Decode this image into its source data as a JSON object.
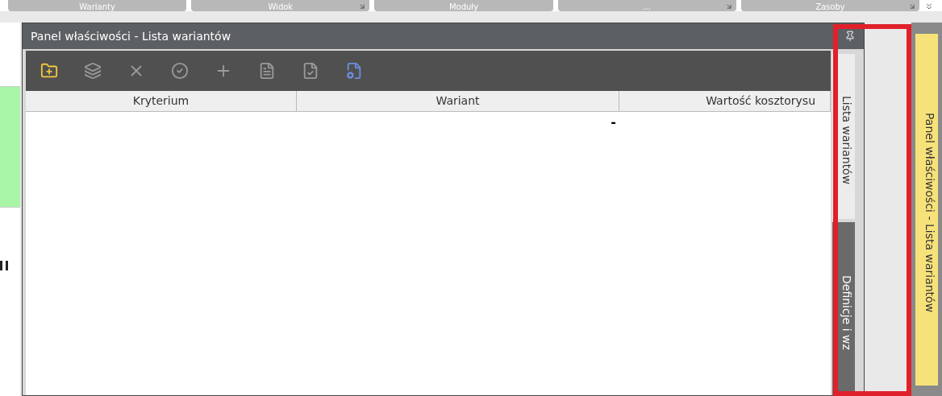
{
  "ribbon_groups": [
    {
      "label": "Warianty",
      "launcher": false
    },
    {
      "label": "Widok",
      "launcher": true
    },
    {
      "label": "Moduły",
      "launcher": false
    },
    {
      "label": "...",
      "launcher": true
    },
    {
      "label": "Zasoby",
      "launcher": true
    }
  ],
  "panel": {
    "title": "Panel właściwości - Lista wariantów",
    "toolbar": [
      {
        "kind": "add-folder",
        "disabled": false
      },
      {
        "kind": "cards",
        "disabled": true
      },
      {
        "kind": "delete",
        "disabled": true
      },
      {
        "kind": "accept",
        "disabled": true
      },
      {
        "kind": "add",
        "disabled": true
      },
      {
        "kind": "document",
        "disabled": true
      },
      {
        "kind": "document-check",
        "disabled": true
      },
      {
        "kind": "document-settings",
        "disabled": false
      }
    ],
    "table": {
      "columns": [
        "Kryterium",
        "Wariant",
        "Wartość kosztorysu"
      ],
      "rows": [
        [
          "",
          "-",
          ""
        ]
      ]
    },
    "tabs": [
      {
        "label": "Lista wariantów",
        "selected": true
      },
      {
        "label": "Definicje i wz",
        "selected": false
      }
    ]
  },
  "side_tab": {
    "label": "Panel właściwości - Lista wariantów"
  }
}
